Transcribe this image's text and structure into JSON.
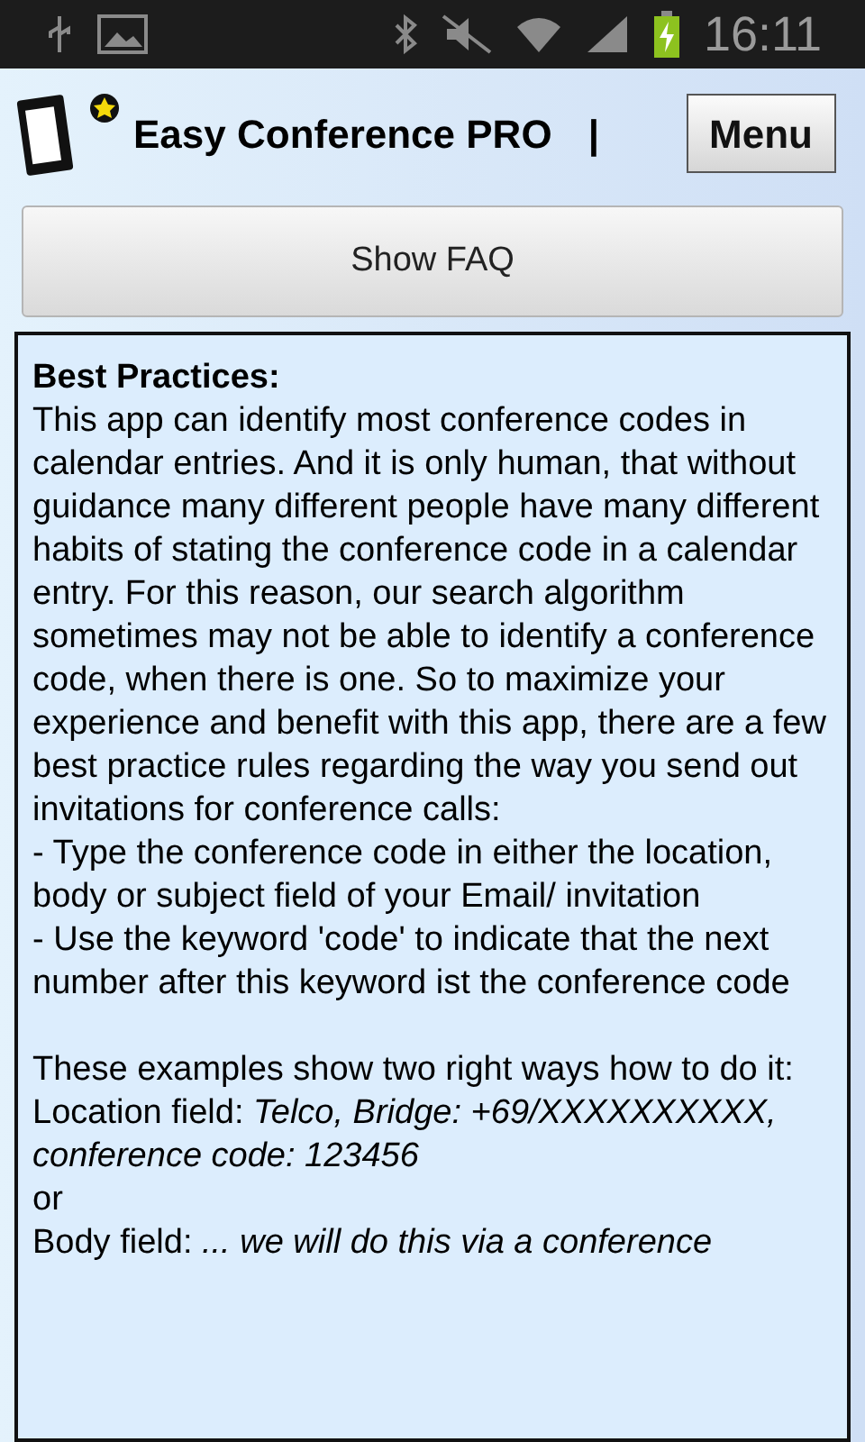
{
  "status_bar": {
    "time": "16:11"
  },
  "header": {
    "title": "Easy Conference PRO",
    "separator": "|",
    "menu_button": "Menu"
  },
  "faq_button": "Show FAQ",
  "content": {
    "heading": "Best Practices:",
    "paragraphs": [
      {
        "kind": "text",
        "text": "This app can identify most conference codes in calendar entries. And it is only human, that without guidance many different people have many different habits of stating the conference code in a calendar entry. For this reason, our search algorithm sometimes may not be able to identify a conference code, when there is one. So to maximize your experience and benefit with this app, there are a few best practice rules regarding the way you send out invitations for conference calls:"
      },
      {
        "kind": "text",
        "text": "- Type the conference code in either the location, body or subject field of your Email/ invitation"
      },
      {
        "kind": "text",
        "text": "- Use the keyword 'code' to indicate that the next number after this keyword ist the conference code"
      },
      {
        "kind": "gap"
      },
      {
        "kind": "text",
        "text": "These examples show two right ways how to do it:"
      },
      {
        "kind": "text",
        "text": "Location field: *Telco, Bridge: +69/XXXXXXXXXX, conference code: 123456*"
      },
      {
        "kind": "text",
        "text": "or"
      },
      {
        "kind": "text",
        "text": "Body field: *... we will do this via a conference*"
      }
    ]
  }
}
